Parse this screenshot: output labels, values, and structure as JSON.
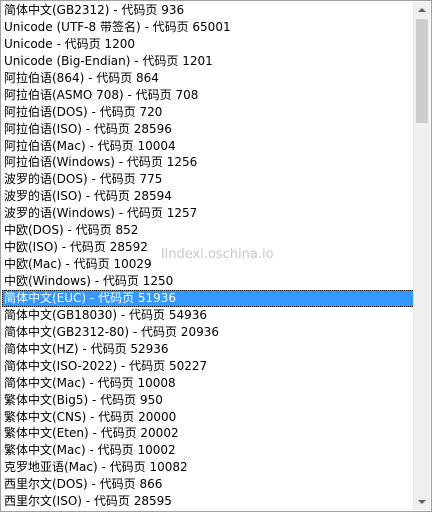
{
  "encodings": {
    "items": [
      "简体中文(GB2312) - 代码页 936",
      "Unicode (UTF-8 带签名) - 代码页 65001",
      "Unicode - 代码页 1200",
      "Unicode (Big-Endian) - 代码页 1201",
      "阿拉伯语(864) - 代码页 864",
      "阿拉伯语(ASMO 708) - 代码页 708",
      "阿拉伯语(DOS) - 代码页 720",
      "阿拉伯语(ISO) - 代码页 28596",
      "阿拉伯语(Mac) - 代码页 10004",
      "阿拉伯语(Windows) - 代码页 1256",
      "波罗的语(DOS) - 代码页 775",
      "波罗的语(ISO) - 代码页 28594",
      "波罗的语(Windows) - 代码页 1257",
      "中欧(DOS) - 代码页 852",
      "中欧(ISO) - 代码页 28592",
      "中欧(Mac) - 代码页 10029",
      "中欧(Windows) - 代码页 1250",
      "简体中文(EUC) - 代码页 51936",
      "简体中文(GB18030) - 代码页 54936",
      "简体中文(GB2312-80) - 代码页 20936",
      "简体中文(HZ) - 代码页 52936",
      "简体中文(ISO-2022) - 代码页 50227",
      "简体中文(Mac) - 代码页 10008",
      "繁体中文(Big5) - 代码页 950",
      "繁体中文(CNS) - 代码页 20000",
      "繁体中文(Eten) - 代码页 20002",
      "繁体中文(Mac) - 代码页 10002",
      "克罗地亚语(Mac) - 代码页 10082",
      "西里尔文(DOS) - 代码页 866",
      "西里尔文(ISO) - 代码页 28595"
    ],
    "selected_index": 17
  },
  "watermark": "lindexi.oschina.io",
  "colors": {
    "selection": "#3399ff",
    "selection_text": "#ffffff",
    "text": "#000000"
  }
}
